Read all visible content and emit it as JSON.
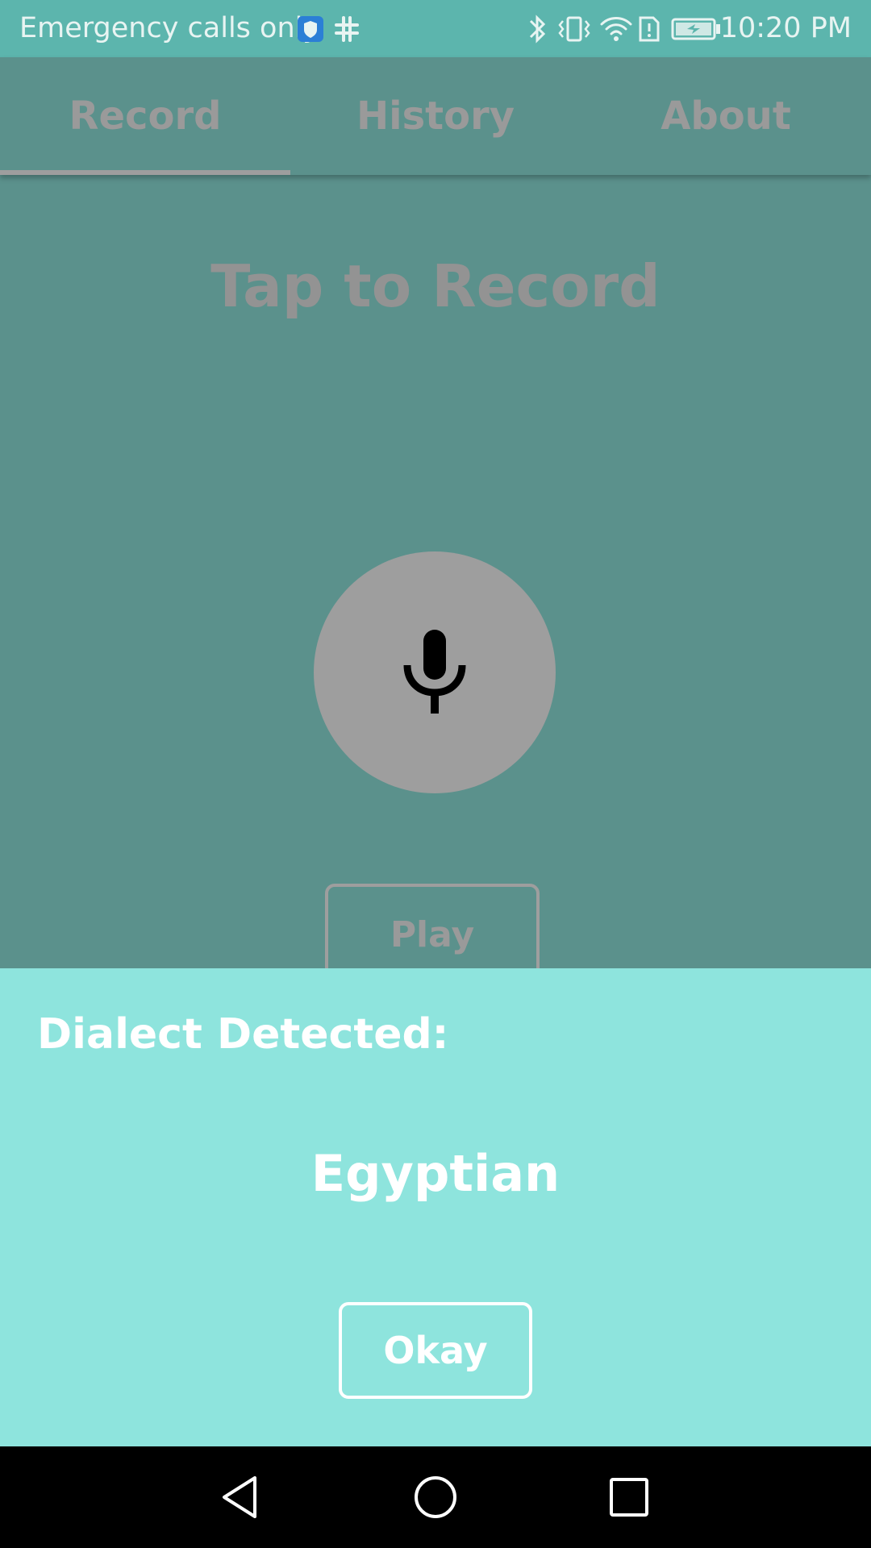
{
  "status_bar": {
    "carrier_text": "Emergency calls only",
    "time": "10:20 PM",
    "icons": [
      "shield-icon",
      "slack-icon",
      "bluetooth-icon",
      "vibrate-icon",
      "wifi-icon",
      "sim-alert-icon",
      "battery-charging-icon"
    ]
  },
  "tabs": [
    {
      "label": "Record",
      "selected": true
    },
    {
      "label": "History",
      "selected": false
    },
    {
      "label": "About",
      "selected": false
    }
  ],
  "main": {
    "title": "Tap to Record",
    "mic_icon": "microphone-icon",
    "play_label": "Play"
  },
  "dialog": {
    "title": "Dialect Detected:",
    "result": "Egyptian",
    "okay_label": "Okay"
  },
  "nav_bar": {
    "icons": [
      "back-icon",
      "home-icon",
      "recents-icon"
    ]
  },
  "colors": {
    "status_bar": "#5cb5ad",
    "app_background": "#5b918c",
    "dialog_background": "#8ee4dd",
    "button_gray": "#9e9e9e"
  }
}
